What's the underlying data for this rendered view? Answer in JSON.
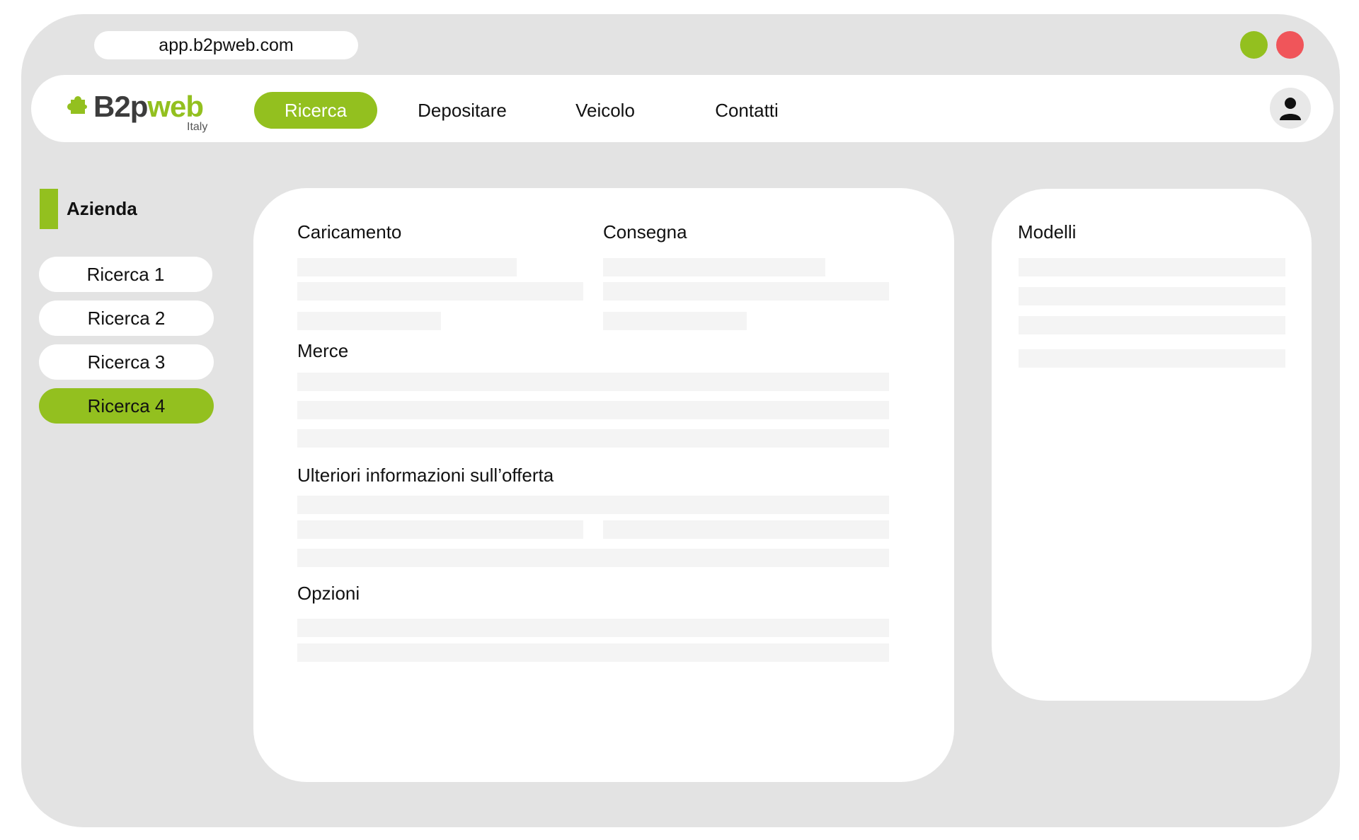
{
  "browser": {
    "url": "app.b2pweb.com"
  },
  "brand": {
    "name_dark": "B2p",
    "name_green": "web",
    "sub": "Italy"
  },
  "nav": {
    "items": [
      {
        "label": "Ricerca",
        "active": true
      },
      {
        "label": "Depositare"
      },
      {
        "label": "Veicolo"
      },
      {
        "label": "Contatti"
      }
    ]
  },
  "sidebar": {
    "title": "Azienda",
    "items": [
      {
        "label": "Ricerca 1"
      },
      {
        "label": "Ricerca 2"
      },
      {
        "label": "Ricerca 3"
      },
      {
        "label": "Ricerca 4",
        "active": true
      }
    ]
  },
  "form": {
    "loading_label": "Caricamento",
    "delivery_label": "Consegna",
    "goods_label": "Merce",
    "more_info_label": "Ulteriori informazioni sull’offerta",
    "options_label": "Opzioni"
  },
  "templates": {
    "title": "Modelli"
  },
  "colors": {
    "accent": "#93c01f",
    "close": "#f0555a",
    "frame": "#e3e3e3",
    "placeholder": "#f4f4f4"
  },
  "icons": {
    "user": "user-icon",
    "logo": "puzzle-icon"
  }
}
